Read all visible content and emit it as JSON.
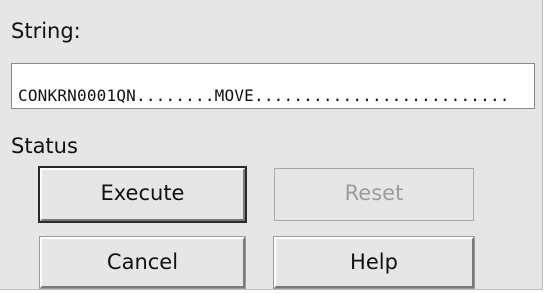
{
  "form": {
    "string_label": "String:",
    "string_value": "CONKRN0001QN........MOVE..........................",
    "status_label": "Status"
  },
  "buttons": {
    "execute": "Execute",
    "reset": "Reset",
    "cancel": "Cancel",
    "help": "Help"
  }
}
